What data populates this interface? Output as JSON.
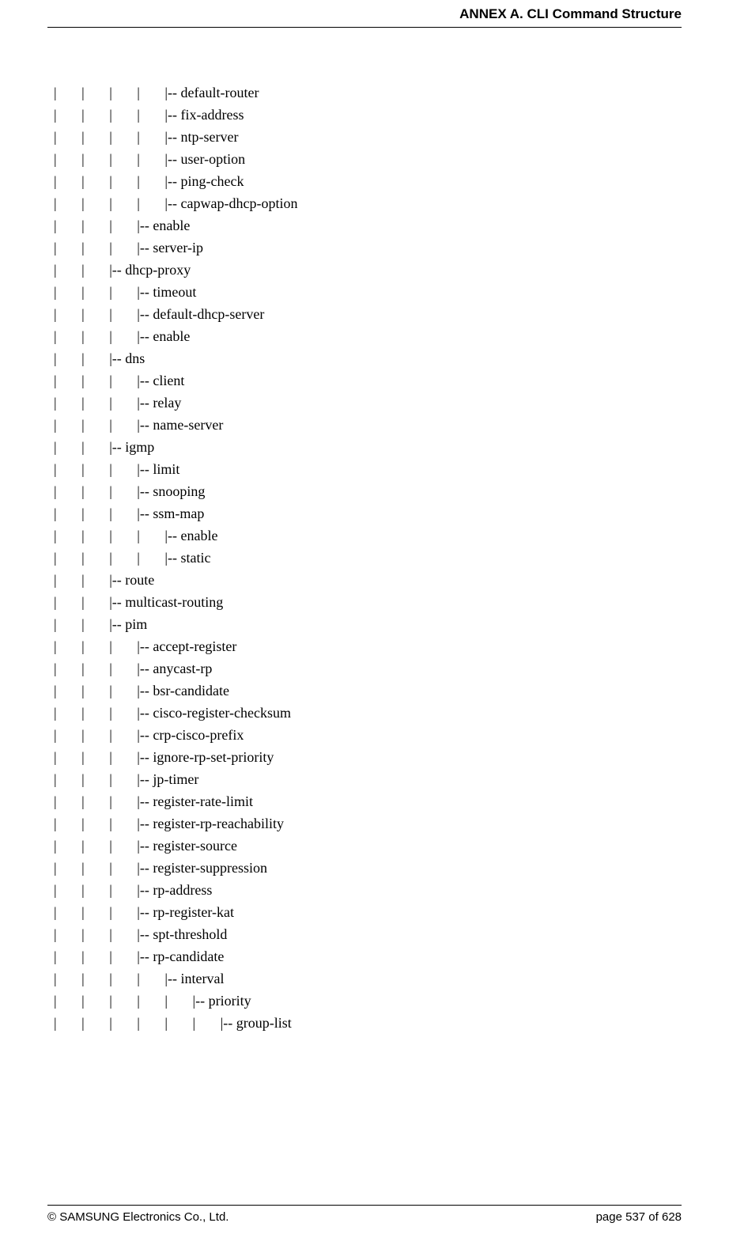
{
  "header": {
    "title": "ANNEX A. CLI Command Structure"
  },
  "tree": {
    "lines": [
      "|       |       |       |       |-- default-router",
      "|       |       |       |       |-- fix-address",
      "|       |       |       |       |-- ntp-server",
      "|       |       |       |       |-- user-option",
      "|       |       |       |       |-- ping-check",
      "|       |       |       |       |-- capwap-dhcp-option",
      "|       |       |       |-- enable",
      "|       |       |       |-- server-ip",
      "|       |       |-- dhcp-proxy",
      "|       |       |       |-- timeout",
      "|       |       |       |-- default-dhcp-server",
      "|       |       |       |-- enable",
      "|       |       |-- dns",
      "|       |       |       |-- client",
      "|       |       |       |-- relay",
      "|       |       |       |-- name-server",
      "|       |       |-- igmp",
      "|       |       |       |-- limit",
      "|       |       |       |-- snooping",
      "|       |       |       |-- ssm-map",
      "|       |       |       |       |-- enable",
      "|       |       |       |       |-- static",
      "|       |       |-- route",
      "|       |       |-- multicast-routing",
      "|       |       |-- pim",
      "|       |       |       |-- accept-register",
      "|       |       |       |-- anycast-rp",
      "|       |       |       |-- bsr-candidate",
      "|       |       |       |-- cisco-register-checksum",
      "|       |       |       |-- crp-cisco-prefix",
      "|       |       |       |-- ignore-rp-set-priority",
      "|       |       |       |-- jp-timer",
      "|       |       |       |-- register-rate-limit",
      "|       |       |       |-- register-rp-reachability",
      "|       |       |       |-- register-source",
      "|       |       |       |-- register-suppression",
      "|       |       |       |-- rp-address",
      "|       |       |       |-- rp-register-kat",
      "|       |       |       |-- spt-threshold",
      "|       |       |       |-- rp-candidate",
      "|       |       |       |       |-- interval",
      "|       |       |       |       |       |-- priority",
      "|       |       |       |       |       |       |-- group-list"
    ]
  },
  "footer": {
    "copyright": "© SAMSUNG Electronics Co., Ltd.",
    "page_label": "page 537 of 628"
  }
}
